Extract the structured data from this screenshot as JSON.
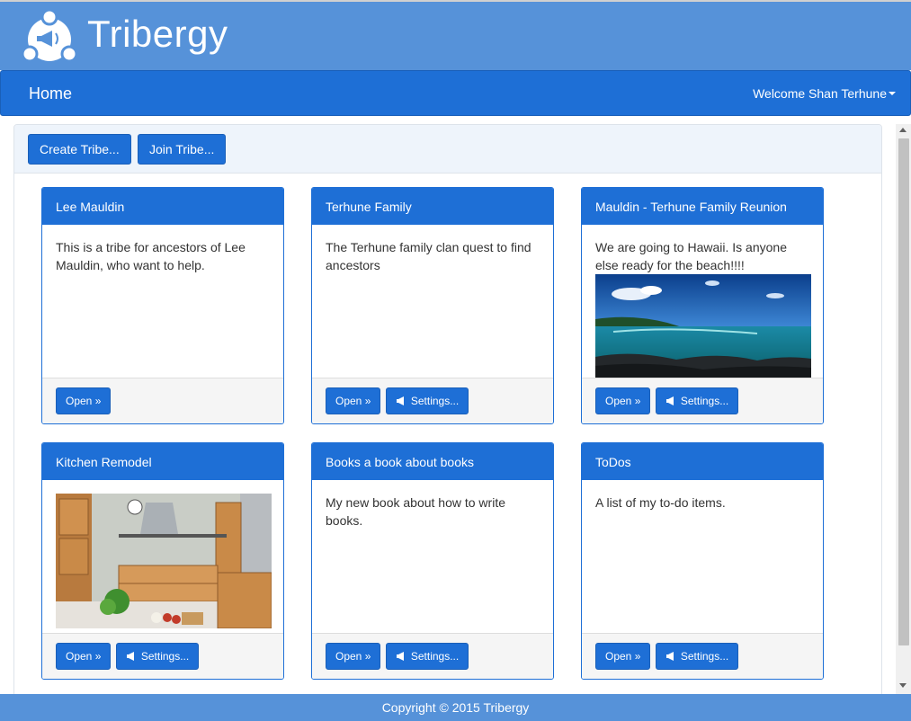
{
  "brand": {
    "name": "Tribergy"
  },
  "nav": {
    "home_label": "Home",
    "user_label": "Welcome Shan Terhune"
  },
  "toolbar": {
    "create_label": "Create Tribe...",
    "join_label": "Join Tribe..."
  },
  "buttons": {
    "open_label": "Open",
    "open_suffix": "»",
    "settings_label": "Settings..."
  },
  "tribes": [
    {
      "title": "Lee Mauldin",
      "description": "This is a tribe for ancestors of Lee Mauldin, who want to help."
    },
    {
      "title": "Terhune Family",
      "description": "The Terhune family clan quest to find ancestors"
    },
    {
      "title": "Mauldin - Terhune Family Reunion",
      "description": "We are going to Hawaii. Is anyone else ready for the beach!!!!"
    },
    {
      "title": "Kitchen Remodel",
      "description": ""
    },
    {
      "title": "Books a book about books",
      "description": "My new book about how to write books."
    },
    {
      "title": "ToDos",
      "description": "A list of my to-do items."
    }
  ],
  "footer": {
    "copyright": "Copyright © 2015 Tribergy"
  },
  "colors": {
    "brand_bar": "#5692d9",
    "primary": "#1e6fd6",
    "panel_head": "#eef4fb"
  },
  "icons": {
    "logo": "tribe-megaphone-logo-icon",
    "settings": "megaphone-icon",
    "user_menu": "caret-down-icon"
  }
}
